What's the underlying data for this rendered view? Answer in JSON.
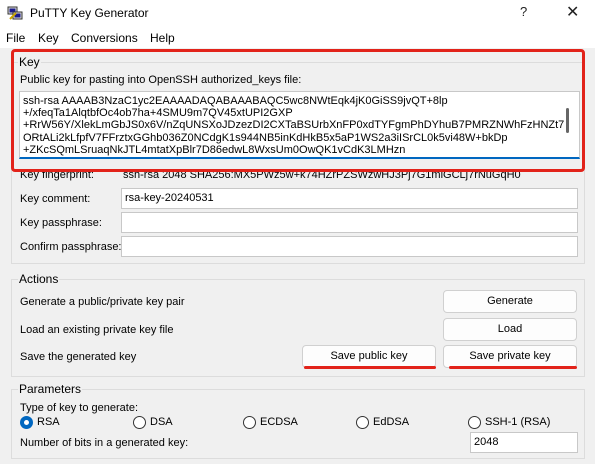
{
  "window": {
    "title": "PuTTY Key Generator",
    "help_glyph": "?",
    "close_glyph": "✕"
  },
  "menu": [
    "File",
    "Key",
    "Conversions",
    "Help"
  ],
  "key_section": {
    "label": "Key",
    "public_key_label": "Public key for pasting into OpenSSH authorized_keys file:",
    "public_key_lines": [
      "ssh-rsa AAAAB3NzaC1yc2EAAAADAQABAAABAQC5wc8NWtEqk4jK0GiSS9jvQT+8lp",
      "+/xfeqTa1AlqtbfOc4ob7ha+4SMU9m7QV45xtUPI2GXP",
      "+RrW56Y/XlekLmGbJS0x6V/nZqUNSXoJDzezDI2CXTaBSUrbXnFP0xdTYFgmPhDYhuB7PMRZNWhFzHNZt7",
      "ORtALi2kLfpfV7FFrztxGGhb036Z0NCdgK1s944NB5inKdHkB5x5aP1WS2a3iISrCL0k5vi48W+bkDp",
      "+ZKcSQmLSruaqNkJTL4mtatXpBlr7D86edwL8WxsUm0OwQK1vCdK3LMHzn"
    ],
    "fingerprint_label": "Key fingerprint:",
    "fingerprint_value": "ssh-rsa 2048 SHA256:MX5PWz5w+k74HZrPZSWzwHJ3Pj7G1mlGCLj7rNuGqH0",
    "comment_label": "Key comment:",
    "comment_value": "rsa-key-20240531",
    "passphrase_label": "Key passphrase:",
    "passphrase_value": "",
    "confirm_label": "Confirm passphrase:",
    "confirm_value": ""
  },
  "actions": {
    "label": "Actions",
    "generate_desc": "Generate a public/private key pair",
    "generate_button": "Generate",
    "load_desc": "Load an existing private key file",
    "load_button": "Load",
    "save_desc": "Save the generated key",
    "save_public_button": "Save public key",
    "save_private_button": "Save private key"
  },
  "parameters": {
    "label": "Parameters",
    "type_label": "Type of key to generate:",
    "key_types": [
      "RSA",
      "DSA",
      "ECDSA",
      "EdDSA",
      "SSH-1 (RSA)"
    ],
    "selected_type": "RSA",
    "bits_label": "Number of bits in a generated key:",
    "bits_value": "2048"
  },
  "annotation_color": "#e2231a",
  "accent_color": "#0067c0"
}
